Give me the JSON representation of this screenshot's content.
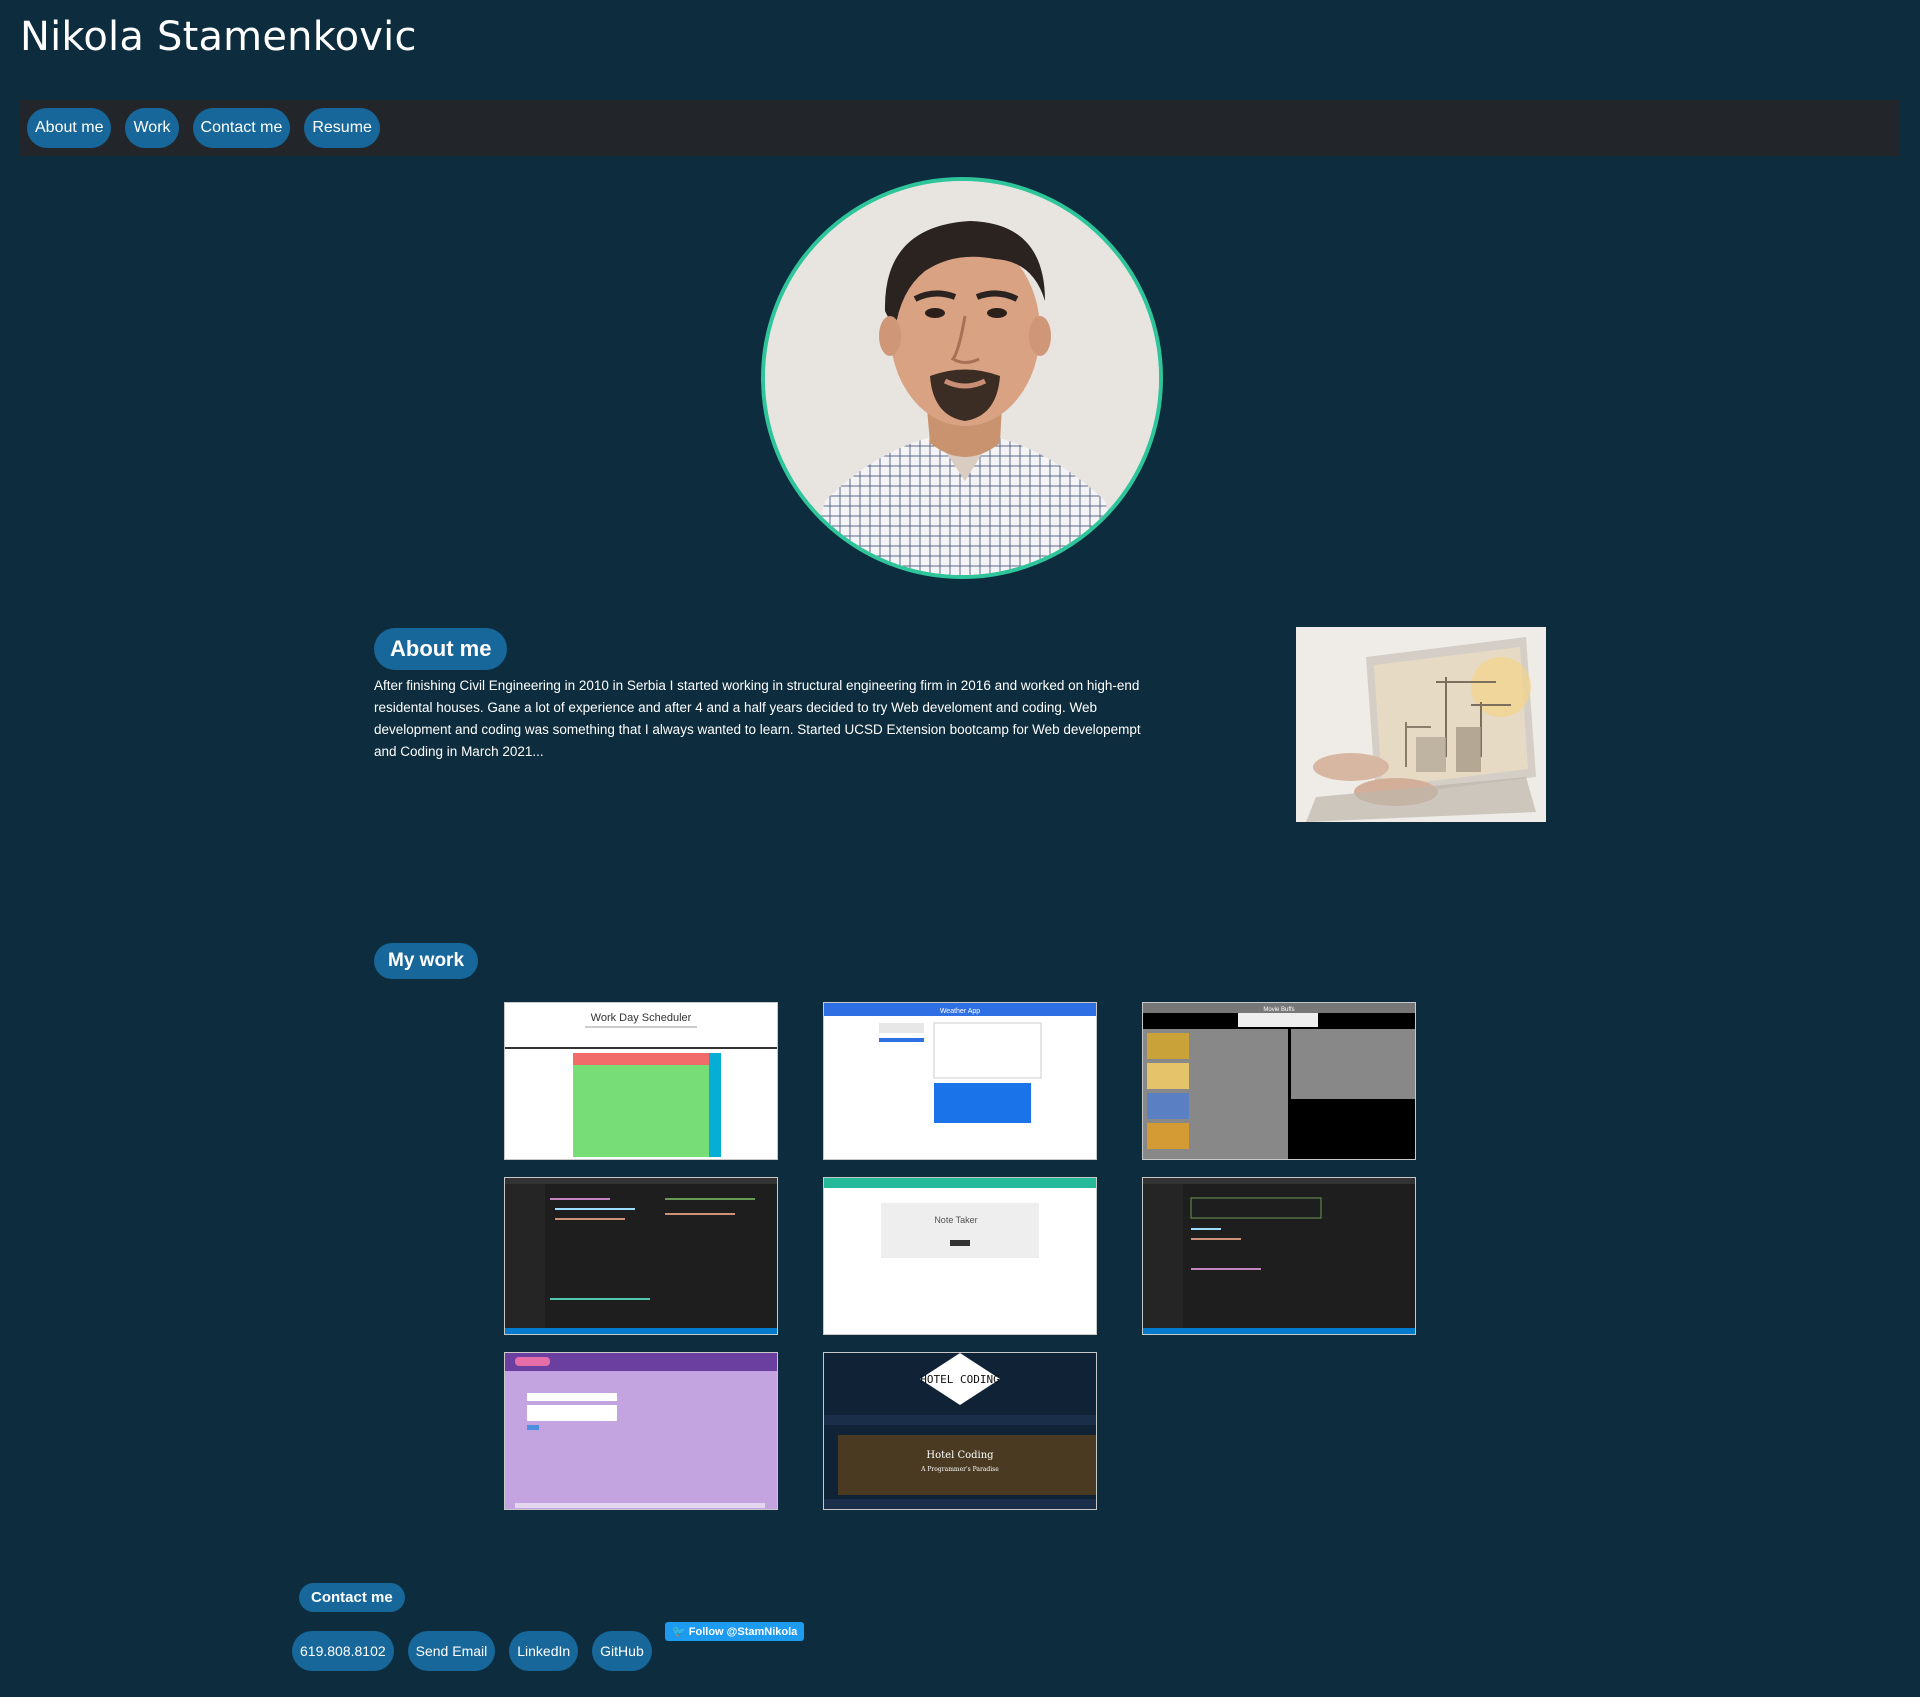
{
  "site": {
    "title": "Nikola Stamenkovic"
  },
  "nav": {
    "items": [
      "About me",
      "Work",
      "Contact me",
      "Resume"
    ]
  },
  "about": {
    "heading": "About me",
    "text": "After finishing Civil Engineering in 2010 in Serbia I started working in structural engineering firm in 2016 and worked on high-end residental houses. Gane a lot of experience and after 4 and a half years decided to try Web develoment and coding. Web development and coding was something that I always wanted to learn. Started UCSD Extension bootcamp for Web developempt and Coding in March 2021..."
  },
  "work": {
    "heading": "My work",
    "projects": [
      {
        "title": "Work Day Scheduler"
      },
      {
        "title": "Weather App"
      },
      {
        "title": "Movie Buffs"
      },
      {
        "title": ""
      },
      {
        "title": "Note Taker"
      },
      {
        "title": ""
      },
      {
        "title": ""
      },
      {
        "title": "HOTEL CODING",
        "subtitle": "Hotel Coding",
        "tagline": "A Programmer's Paradise"
      }
    ]
  },
  "contact": {
    "heading": "Contact me",
    "links": [
      "619.808.8102",
      "Send Email",
      "LinkedIn",
      "GitHub"
    ],
    "twitter": "Follow @StamNikola"
  },
  "colors": {
    "background": "#0d2d3e",
    "navbar": "#22252a",
    "accent": "#17679a",
    "avatar_ring": "#2fc59a",
    "twitter": "#1d9bf0"
  },
  "icons": [
    "profile-photo",
    "twitter-bird-icon"
  ]
}
